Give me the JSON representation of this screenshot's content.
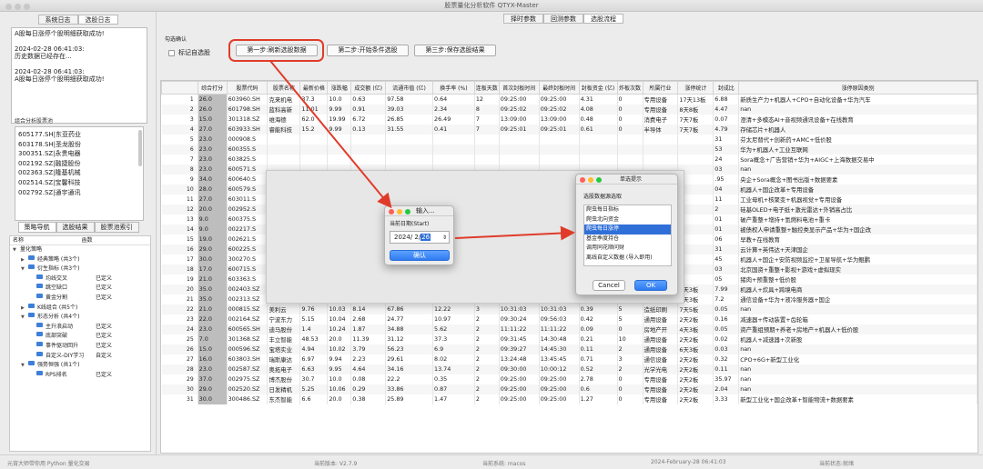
{
  "window": {
    "title": "股票量化分析软件 QTYX-Master"
  },
  "left": {
    "tabs": [
      "系统日志",
      "选股日志"
    ],
    "log": [
      "A股每日涨停个股明细获取成功!",
      "2024-02-28 06:41:03:\n历史数据已经存在...",
      "2024-02-28 06:41:03:\nA股每日涨停个股明细获取成功!"
    ],
    "pool_label": "组合分析股票池",
    "pool": [
      "605177.SH|东亚药业",
      "603178.SH|圣龙股份",
      "300351.SZ|永贵电器",
      "002192.SZ|融捷股份",
      "002363.SZ|隆基机械",
      "002514.SZ|宝馨科技",
      "002792.SZ|通宇通讯"
    ],
    "nav_tabs": [
      "策略导航",
      "选股结果",
      "股票池索引"
    ],
    "tree_header": {
      "name": "名称",
      "func": "函数"
    },
    "tree": [
      {
        "d": 0,
        "t": "▼",
        "name": "量化策略",
        "func": "",
        "f": false
      },
      {
        "d": 1,
        "t": "▶",
        "name": "经典策略 (共3个)",
        "func": "",
        "f": true
      },
      {
        "d": 1,
        "t": "▼",
        "name": "衍生指标 (共3个)",
        "func": "",
        "f": true
      },
      {
        "d": 2,
        "t": "",
        "name": "均线交叉",
        "func": "已定义",
        "f": true
      },
      {
        "d": 2,
        "t": "",
        "name": "跳空缺口",
        "func": "已定义",
        "f": true
      },
      {
        "d": 2,
        "t": "",
        "name": "黄金分割",
        "func": "已定义",
        "f": true
      },
      {
        "d": 1,
        "t": "▶",
        "name": "K线组合 (共5个)",
        "func": "",
        "f": true
      },
      {
        "d": 1,
        "t": "▼",
        "name": "形态分析 (共4个)",
        "func": "",
        "f": true
      },
      {
        "d": 2,
        "t": "",
        "name": "主升浪启动",
        "func": "已定义",
        "f": true
      },
      {
        "d": 2,
        "t": "",
        "name": "底部突破",
        "func": "已定义",
        "f": true
      },
      {
        "d": 2,
        "t": "",
        "name": "事件驱动回升",
        "func": "已定义",
        "f": true
      },
      {
        "d": 2,
        "t": "",
        "name": "自定义-DIY学习",
        "func": "自定义",
        "f": true
      },
      {
        "d": 1,
        "t": "▼",
        "name": "强势恒强 (共1个)",
        "func": "",
        "f": true
      },
      {
        "d": 2,
        "t": "",
        "name": "RPS排名",
        "func": "已定义",
        "f": true
      }
    ]
  },
  "main": {
    "top_tabs": [
      "择时参数",
      "回测参数",
      "选股流程"
    ],
    "group_label": "勾选确认",
    "checkbox_label": "标记自选股",
    "steps": [
      "第一步:刷新选股数据",
      "第二步:开始条件选股",
      "第三步:保存选股结果"
    ]
  },
  "table": {
    "headers": [
      "",
      "综合打分",
      "股票代码",
      "股票名称",
      "最新价格",
      "涨跌幅",
      "成交额 (亿)",
      "流通市值 (亿)",
      "换手率 (%)",
      "连板天数",
      "首次封板时间",
      "最终封板时间",
      "封板资金 (亿)",
      "炸板次数",
      "所属行业",
      "涨停统计",
      "封成比",
      "涨停原因类别"
    ],
    "rows": [
      [
        "1",
        "26.0",
        "603960.SH",
        "克来机电",
        "37.3",
        "10.0",
        "0.63",
        "97.58",
        "0.64",
        "12",
        "09:25:00",
        "09:25:00",
        "4.31",
        "0",
        "专用设备",
        "17天13板",
        "6.88",
        "新质生产力+机器人+CPO+自动化设备+华为汽车"
      ],
      [
        "2",
        "26.0",
        "601798.SH",
        "蓝科高新",
        "11.01",
        "9.99",
        "0.91",
        "39.03",
        "2.34",
        "8",
        "09:25:02",
        "09:25:02",
        "4.08",
        "0",
        "专用设备",
        "8天8板",
        "4.47",
        "nan"
      ],
      [
        "3",
        "15.0",
        "301318.SZ",
        "维海德",
        "62.0",
        "19.99",
        "6.72",
        "26.85",
        "26.49",
        "7",
        "13:09:00",
        "13:09:00",
        "0.48",
        "0",
        "消费电子",
        "7天7板",
        "0.07",
        "澄清+多模态AI+音视频通讯设备+在线教育"
      ],
      [
        "4",
        "27.0",
        "603933.SH",
        "睿能科技",
        "15.2",
        "9.99",
        "0.13",
        "31.55",
        "0.41",
        "7",
        "09:25:01",
        "09:25:01",
        "0.61",
        "0",
        "半导体",
        "7天7板",
        "4.79",
        "存储芯片+机器人"
      ],
      [
        "5",
        "23.0",
        "000908.S",
        "",
        "",
        "",
        "",
        "",
        "",
        "",
        "",
        "",
        "",
        "",
        "",
        "",
        "31",
        "芬太尼替代+创新药+AMC+低价股"
      ],
      [
        "6",
        "23.0",
        "600355.S",
        "",
        "",
        "",
        "",
        "",
        "",
        "",
        "",
        "",
        "",
        "",
        "",
        "",
        "53",
        "华为+机器人+工业互联网"
      ],
      [
        "7",
        "23.0",
        "603825.S",
        "",
        "",
        "",
        "",
        "",
        "",
        "",
        "",
        "",
        "",
        "",
        "",
        "",
        "24",
        "Sora概念+广告营销+华为+AIGC+上海数据交易中"
      ],
      [
        "8",
        "23.0",
        "600571.S",
        "",
        "",
        "",
        "",
        "",
        "",
        "",
        "",
        "",
        "",
        "",
        "",
        "",
        "03",
        "nan"
      ],
      [
        "9",
        "34.0",
        "600640.S",
        "",
        "",
        "",
        "",
        "",
        "",
        "",
        "",
        "",
        "",
        "",
        "",
        "",
        ".95",
        "央企+Sora概念+图书出版+数据要素"
      ],
      [
        "10",
        "28.0",
        "600579.S",
        "",
        "",
        "",
        "",
        "",
        "",
        "",
        "",
        "",
        "",
        "",
        "",
        "",
        "04",
        "机器人+国企改革+专用设备"
      ],
      [
        "11",
        "27.0",
        "603011.S",
        "",
        "",
        "",
        "",
        "",
        "",
        "",
        "",
        "",
        "",
        "",
        "",
        "",
        "11",
        "工业母机+核聚变+机器视觉+专用设备"
      ],
      [
        "12",
        "20.0",
        "002952.S",
        "",
        "",
        "",
        "",
        "",
        "",
        "",
        "",
        "",
        "",
        "",
        "",
        "",
        "2",
        "硅基OLED+电子纸+激光雷达+外销高占比"
      ],
      [
        "13",
        "9.0",
        "600375.S",
        "",
        "",
        "",
        "",
        "",
        "",
        "",
        "",
        "",
        "",
        "",
        "",
        "",
        "01",
        "破产重整+增持+氢燃料电池+重卡"
      ],
      [
        "14",
        "9.0",
        "002217.S",
        "",
        "",
        "",
        "",
        "",
        "",
        "",
        "",
        "",
        "",
        "",
        "",
        "",
        "01",
        "被债权人申请重整+触控类显示产品+华为+国企改"
      ],
      [
        "15",
        "19.0",
        "002621.S",
        "",
        "",
        "",
        "",
        "",
        "",
        "",
        "",
        "",
        "",
        "",
        "",
        "",
        "06",
        "早教+在线教育"
      ],
      [
        "16",
        "29.0",
        "600225.S",
        "",
        "",
        "",
        "",
        "",
        "",
        "",
        "",
        "",
        "",
        "",
        "",
        "",
        "31",
        "云计算+英伟达+天津国企"
      ],
      [
        "17",
        "30.0",
        "300270.S",
        "",
        "",
        "",
        "",
        "",
        "",
        "",
        "",
        "",
        "",
        "",
        "",
        "",
        "45",
        "机器人+国企+安防视频监控+卫星导航+华为鲲鹏"
      ],
      [
        "18",
        "17.0",
        "600715.S",
        "",
        "",
        "",
        "",
        "",
        "",
        "",
        "",
        "",
        "",
        "",
        "",
        "",
        "03",
        "北京国资+重整+影视+游戏+虚拟现实"
      ],
      [
        "19",
        "21.0",
        "603363.S",
        "",
        "",
        "",
        "",
        "",
        "",
        "",
        "",
        "",
        "",
        "",
        "",
        "",
        "05",
        "猪肉+预重整+低价股"
      ],
      [
        "20",
        "35.0",
        "002403.SZ",
        "爱仕达",
        "8.26",
        "9.99",
        "0.14",
        "25.27",
        "0.55",
        "3",
        "09:25:00",
        "09:25:00",
        "1.11",
        "0",
        "家电行业",
        "3天3板",
        "7.99",
        "机器人+炊具+跨境电商"
      ],
      [
        "21",
        "35.0",
        "002313.SZ",
        "日海智能",
        "8.56",
        "10.03",
        "0.07",
        "32.04",
        "0.21",
        "3",
        "09:25:00",
        "09:25:00",
        "0.49",
        "0",
        "通信设备",
        "3天3板",
        "7.2",
        "通信设备+华为+液冷服务器+国企"
      ],
      [
        "22",
        "21.0",
        "000815.SZ",
        "美利云",
        "9.76",
        "10.03",
        "8.14",
        "67.86",
        "12.22",
        "3",
        "10:31:03",
        "10:31:03",
        "0.39",
        "5",
        "造纸印刷",
        "7天5板",
        "0.05",
        "nan"
      ],
      [
        "23",
        "22.0",
        "002164.SZ",
        "宁波东力",
        "5.15",
        "10.04",
        "2.68",
        "24.77",
        "10.97",
        "2",
        "09:30:24",
        "09:56:03",
        "0.42",
        "5",
        "通用设备",
        "2天2板",
        "0.16",
        "减速器+传动装置+齿轮箱"
      ],
      [
        "24",
        "23.0",
        "600565.SH",
        "迪马股份",
        "1.4",
        "10.24",
        "1.87",
        "34.88",
        "5.62",
        "2",
        "11:11:22",
        "11:11:22",
        "0.09",
        "0",
        "房地产开",
        "4天3板",
        "0.05",
        "资产重组预期+养老+房地产+机器人+低价股"
      ],
      [
        "25",
        "7.0",
        "301368.SZ",
        "丰立智能",
        "48.53",
        "20.0",
        "11.39",
        "31.12",
        "37.3",
        "2",
        "09:31:45",
        "14:30:48",
        "0.21",
        "10",
        "通用设备",
        "2天2板",
        "0.02",
        "机器人+减速器+次新股"
      ],
      [
        "26",
        "15.0",
        "000596.SZ",
        "宝塔实业",
        "4.94",
        "10.02",
        "3.79",
        "56.23",
        "6.9",
        "2",
        "09:39:27",
        "14:45:30",
        "0.11",
        "2",
        "通用设备",
        "6天3板",
        "0.03",
        "nan"
      ],
      [
        "27",
        "16.0",
        "603803.SH",
        "瑞斯康达",
        "6.97",
        "9.94",
        "2.23",
        "29.61",
        "8.02",
        "2",
        "13:24:48",
        "13:45:45",
        "0.71",
        "3",
        "通信设备",
        "2天2板",
        "0.32",
        "CPO+6G+新型工业化"
      ],
      [
        "28",
        "23.0",
        "002587.SZ",
        "奥拓电子",
        "6.63",
        "9.95",
        "4.64",
        "34.16",
        "13.74",
        "2",
        "09:30:00",
        "10:00:12",
        "0.52",
        "2",
        "光学光电",
        "2天2板",
        "0.11",
        "nan"
      ],
      [
        "29",
        "37.0",
        "002975.SZ",
        "博杰股份",
        "30.7",
        "10.0",
        "0.08",
        "22.2",
        "0.35",
        "2",
        "09:25:00",
        "09:25:00",
        "2.78",
        "0",
        "专用设备",
        "2天2板",
        "35.97",
        "nan"
      ],
      [
        "30",
        "29.0",
        "002520.SZ",
        "日发精机",
        "5.25",
        "10.06",
        "0.29",
        "33.86",
        "0.87",
        "2",
        "09:25:00",
        "09:25:00",
        "0.6",
        "0",
        "专用设备",
        "2天2板",
        "2.04",
        "nan"
      ],
      [
        "31",
        "30.0",
        "300486.SZ",
        "东杰智能",
        "6.6",
        "20.0",
        "0.38",
        "25.89",
        "1.47",
        "2",
        "09:25:00",
        "09:25:00",
        "1.27",
        "0",
        "专用设备",
        "2天2板",
        "3.33",
        "新型工业化+国企改革+智能物流+数据要素"
      ]
    ]
  },
  "date_dialog": {
    "title": "输入...",
    "label": "当前日期(Start)",
    "date_prefix": "2024/ 2/",
    "day": "26",
    "ok": "确认"
  },
  "source_dialog": {
    "title": "单选提示",
    "label": "选股数据源选取",
    "options": [
      "爬虫每日指标",
      "爬虫北向资金",
      "爬虫每日涨停",
      "基金季度持仓",
      "调用同花顺问财",
      "离线自定义数据 (导入即用)"
    ],
    "selected": 2,
    "cancel": "Cancel",
    "ok": "OK"
  },
  "statusbar": {
    "author": "元宵大师带你用 Python 量化交易",
    "version": "当前版本: V2.7.9",
    "system": "当前系统: macos",
    "datetime": "2024-February-28 06:41:03",
    "state": "当前状态:就绪"
  },
  "colors": {
    "highlight": "#e03b2a",
    "select": "#2f6fd8",
    "ok_button": "#2f7bf0"
  }
}
